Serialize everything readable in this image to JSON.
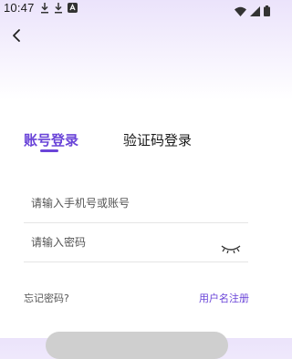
{
  "status_bar": {
    "time": "10:47",
    "left_icons": [
      "download-icon",
      "download-icon",
      "app-notification-icon"
    ],
    "right_icons": [
      "wifi-icon",
      "signal-icon",
      "battery-icon"
    ]
  },
  "nav": {
    "back_icon": "chevron-left-icon"
  },
  "tabs": [
    {
      "label": "账号登录",
      "active": true
    },
    {
      "label": "验证码登录",
      "active": false
    }
  ],
  "form": {
    "phone_placeholder": "请输入手机号或账号",
    "password_placeholder": "请输入密码",
    "password_toggle_icon": "eye-closed-icon"
  },
  "links": {
    "forgot_password": "忘记密码?",
    "register": "用户名注册"
  },
  "colors": {
    "accent": "#6a44d8",
    "header_gradient_top": "#ebe3fb",
    "divider": "#e5e5e5",
    "button_disabled": "#cfcfcf"
  }
}
